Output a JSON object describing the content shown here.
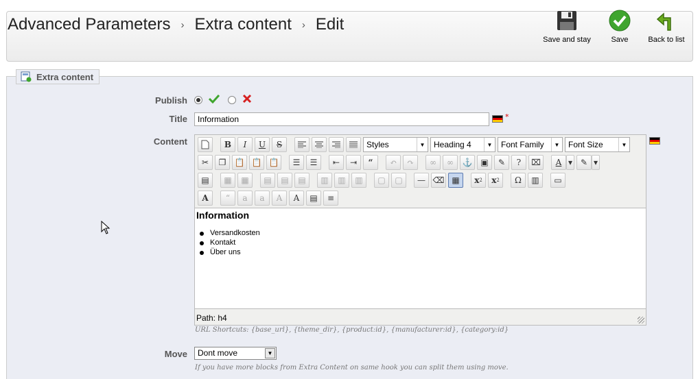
{
  "breadcrumb": [
    "Advanced Parameters",
    "Extra content",
    "Edit"
  ],
  "breadcrumb_sep": "›",
  "toolbar": {
    "save_stay": "Save and stay",
    "save": "Save",
    "back": "Back to list"
  },
  "fieldset": {
    "legend": "Extra content"
  },
  "form": {
    "publish_label": "Publish",
    "title_label": "Title",
    "title_value": "Information",
    "content_label": "Content",
    "move_label": "Move",
    "required_mark": "*"
  },
  "editor": {
    "styles": "Styles",
    "format": "Heading 4",
    "font_family": "Font Family",
    "font_size": "Font Size",
    "heading": "Information",
    "list": [
      "Versandkosten",
      "Kontakt",
      "Über uns"
    ],
    "path": "Path: h4"
  },
  "url_shortcuts": "URL Shortcuts: {base_url}, {theme_dir}, {product:id}, {manufacturer:id}, {category:id}",
  "move_value": "Dont move",
  "move_hint": "If you have more blocks from Extra Content on same hook you can split them using move.",
  "colors": {
    "accent_green": "#3fa52e",
    "back_green": "#6cae1f",
    "error_red": "#d62020"
  }
}
